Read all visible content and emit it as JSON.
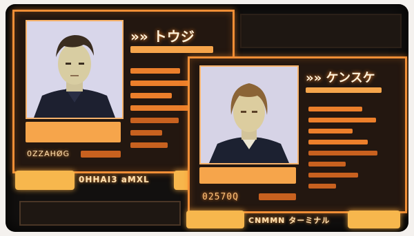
{
  "card1": {
    "name": "»» トウジ",
    "code": "0ZZAHØG",
    "footer": "0HHAI3 aMXL",
    "portrait_icon": "male-student-icon"
  },
  "card2": {
    "name": "»» ケンスケ",
    "code": "02570Q",
    "footer": "CNMMN ターミナル",
    "portrait_icon": "female-student-icon"
  },
  "colors": {
    "accent": "#f08e36",
    "glow": "#f7b74d",
    "screen": "#12100f"
  }
}
